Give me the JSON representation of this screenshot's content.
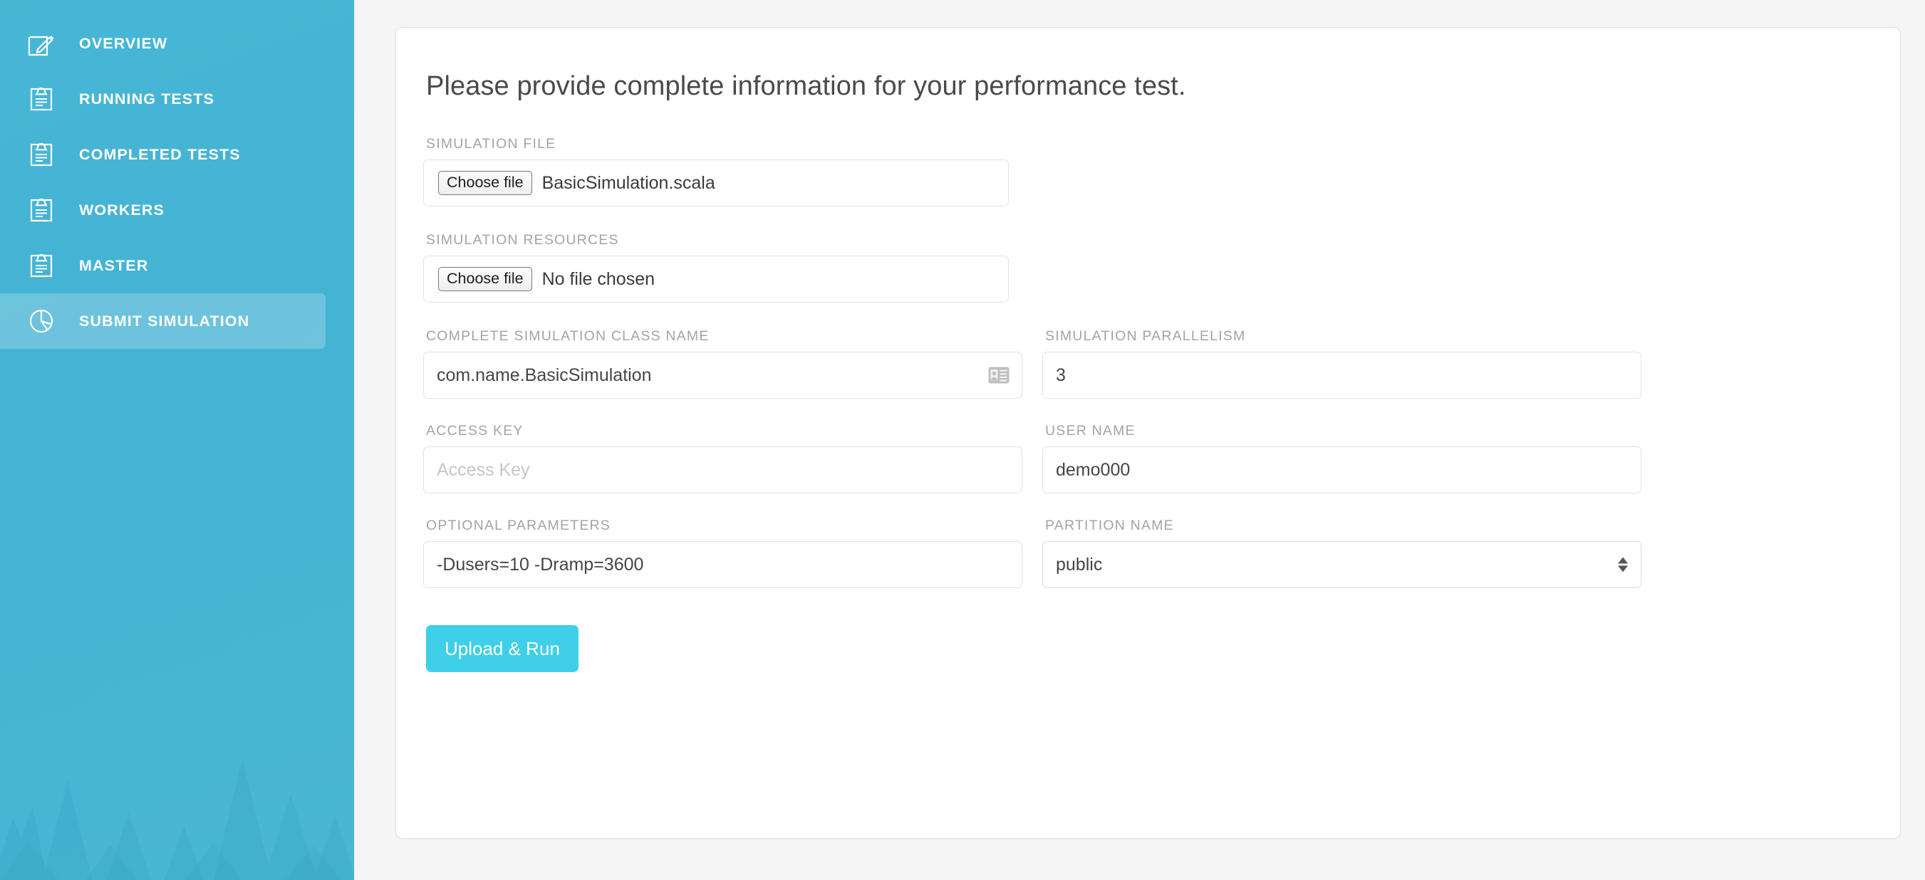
{
  "theme": {
    "sidebar_gradient_from": "#48b7d6",
    "sidebar_gradient_to": "#4ab6d3",
    "accent_button": "#3fcfe9",
    "page_background": "#f5f5f5",
    "label_color": "#a4a4a4",
    "text_color": "#454545"
  },
  "sidebar": {
    "items": [
      {
        "label": "OVERVIEW",
        "icon": "edit-square-icon",
        "active": false
      },
      {
        "label": "RUNNING TESTS",
        "icon": "clipboard-icon",
        "active": false
      },
      {
        "label": "COMPLETED TESTS",
        "icon": "clipboard-icon",
        "active": false
      },
      {
        "label": "WORKERS",
        "icon": "clipboard-icon",
        "active": false
      },
      {
        "label": "MASTER",
        "icon": "clipboard-icon",
        "active": false
      },
      {
        "label": "SUBMIT SIMULATION",
        "icon": "pie-chart-icon",
        "active": true
      }
    ]
  },
  "card": {
    "title": "Please provide complete information for your performance test.",
    "fields": {
      "simulation_file": {
        "label": "SIMULATION FILE",
        "button_label": "Choose file",
        "value": "BasicSimulation.scala"
      },
      "simulation_resources": {
        "label": "SIMULATION RESOURCES",
        "button_label": "Choose file",
        "value": "No file chosen"
      },
      "simulation_class_name": {
        "label": "COMPLETE SIMULATION CLASS NAME",
        "value": "com.name.BasicSimulation",
        "placeholder": "",
        "icon": "contact-card-icon"
      },
      "simulation_parallelism": {
        "label": "SIMULATION PARALLELISM",
        "value": "3",
        "placeholder": ""
      },
      "access_key": {
        "label": "ACCESS KEY",
        "value": "",
        "placeholder": "Access Key"
      },
      "user_name": {
        "label": "USER NAME",
        "value": "demo000",
        "placeholder": ""
      },
      "optional_parameters": {
        "label": "OPTIONAL PARAMETERS",
        "value": "-Dusers=10 -Dramp=3600",
        "placeholder": ""
      },
      "partition_name": {
        "label": "PARTITION NAME",
        "value": "public",
        "options": [
          "public"
        ]
      }
    },
    "submit_button": "Upload & Run"
  }
}
